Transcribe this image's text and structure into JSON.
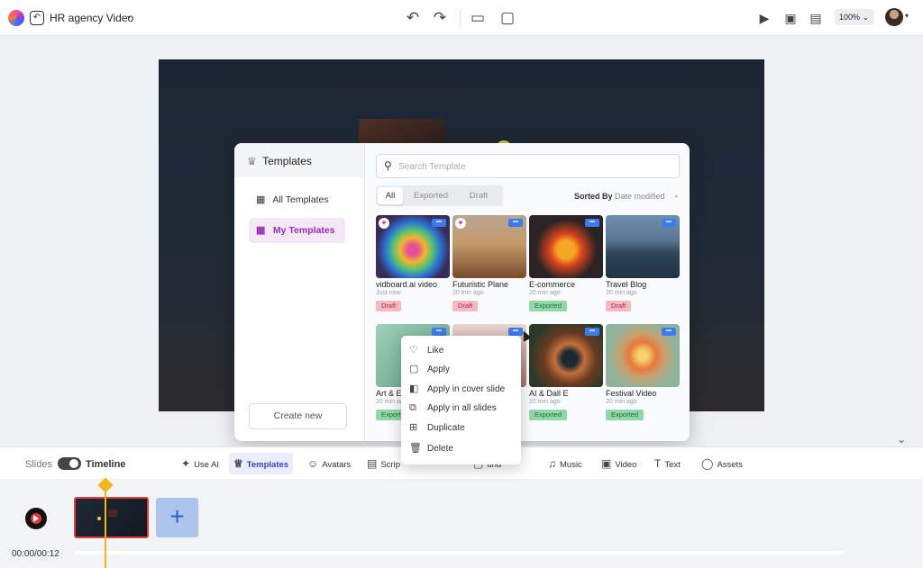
{
  "header": {
    "project_title": "HR agency Video",
    "zoom": "100%"
  },
  "modal": {
    "title": "Templates",
    "side_items": [
      {
        "label": "All Templates",
        "active": false
      },
      {
        "label": "My Templates",
        "active": true
      }
    ],
    "create_new": "Create new",
    "search_placeholder": "Search Template",
    "filter_tabs": [
      {
        "label": "All",
        "active": true
      },
      {
        "label": "Exported",
        "active": false
      },
      {
        "label": "Draft",
        "active": false
      }
    ],
    "sorted_by_label": "Sorted By",
    "sorted_by_value": "Date modified",
    "templates": [
      {
        "title": "vidboard.ai video",
        "time": "Just now",
        "status": "Draft",
        "liked": true
      },
      {
        "title": "Futuristic Plane",
        "time": "20 min ago",
        "status": "Draft",
        "liked": true
      },
      {
        "title": "E-commerce",
        "time": "20 min ago",
        "status": "Exported",
        "liked": false
      },
      {
        "title": "Travel Blog",
        "time": "20 min ago",
        "status": "Draft",
        "liked": false
      },
      {
        "title": "Art & E",
        "time": "20 min ag",
        "status": "Export",
        "liked": false
      },
      {
        "title": "",
        "time": "",
        "status": "",
        "liked": false
      },
      {
        "title": "AI & Dall E",
        "time": "20 min ago",
        "status": "Exported",
        "liked": false
      },
      {
        "title": "Festival Video",
        "time": "20 min ago",
        "status": "Exported",
        "liked": false
      }
    ]
  },
  "context_menu": {
    "items": [
      {
        "label": "Like",
        "icon": "heart-outline-icon"
      },
      {
        "label": "Apply",
        "icon": "slide-icon"
      },
      {
        "label": "Apply in cover slide",
        "icon": "cover-slide-icon"
      },
      {
        "label": "Apply in all slides",
        "icon": "all-slides-icon"
      },
      {
        "label": "Duplicate",
        "icon": "duplicate-icon"
      },
      {
        "label": "Delete",
        "icon": "trash-icon"
      }
    ]
  },
  "toolbar": {
    "slides_label": "Slides",
    "timeline_label": "Timeline",
    "tools": [
      {
        "label": "Use AI",
        "icon": "sparkle-icon"
      },
      {
        "label": "Templates",
        "icon": "crown-icon",
        "active": true
      },
      {
        "label": "Avatars",
        "icon": "avatars-icon"
      },
      {
        "label": "Scrip",
        "icon": "script-icon"
      },
      {
        "label": "und",
        "icon": "background-icon"
      },
      {
        "label": "Music",
        "icon": "music-icon"
      },
      {
        "label": "Video",
        "icon": "video-icon"
      },
      {
        "label": "Text",
        "icon": "text-icon"
      },
      {
        "label": "Assets",
        "icon": "assets-icon"
      }
    ]
  },
  "timeline": {
    "time": "00:00/00:12"
  }
}
